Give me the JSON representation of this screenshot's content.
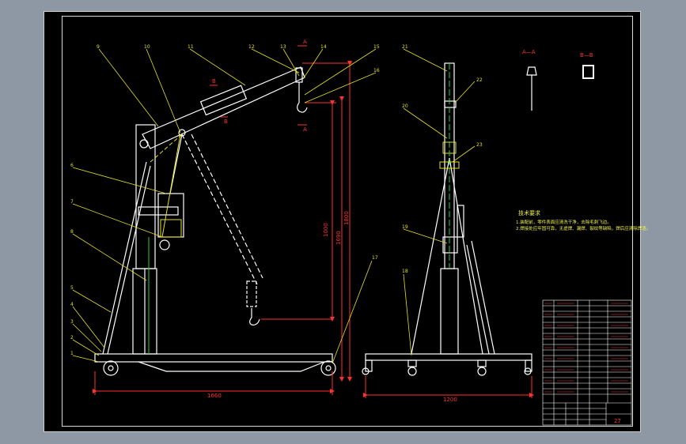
{
  "callouts_left": [
    "1",
    "2",
    "3",
    "4",
    "5",
    "6",
    "7",
    "8",
    "9",
    "10",
    "11",
    "12",
    "13",
    "14",
    "15",
    "16",
    "17"
  ],
  "callouts_right": [
    "18",
    "19",
    "20",
    "21",
    "22",
    "23"
  ],
  "section_a": "A",
  "section_b": "B",
  "view_a_title": "A—A",
  "view_b_title": "B—B",
  "dim_width_left": "1660",
  "dim_width_right": "1200",
  "dim_height_1": "1000",
  "dim_height_2": "1690",
  "dim_height_3": "1800",
  "tech_title": "技术要求",
  "tech_line_1": "1.装配前，零件表面应清洗干净，去除毛刺飞边。",
  "tech_line_2": "2.焊接处应牢固可靠，无虚焊、漏焊、裂纹等缺陷，焊后应清除焊渣。",
  "title_block_num": "27"
}
